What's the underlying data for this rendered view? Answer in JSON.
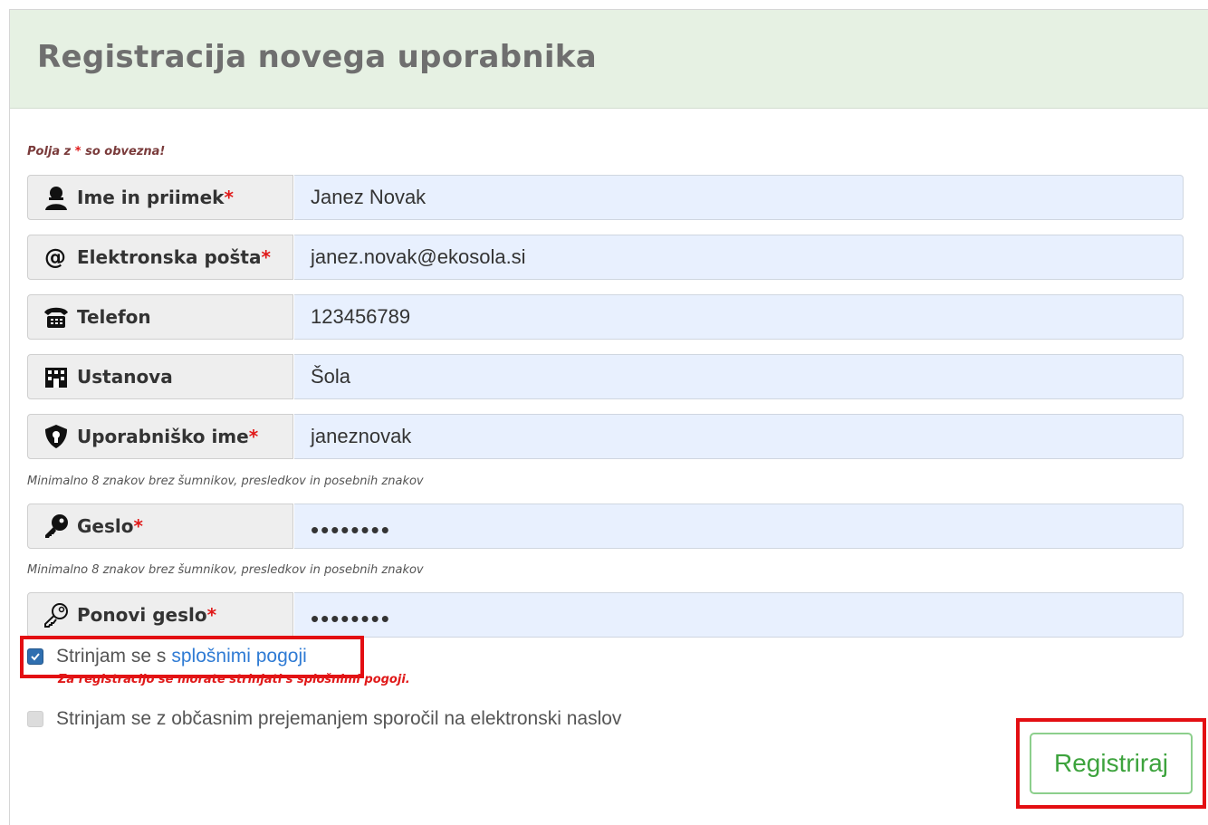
{
  "title": "Registracija novega uporabnika",
  "required_note": {
    "prefix": "Polja z ",
    "star": "*",
    "suffix": " so obvezna!"
  },
  "fields": [
    {
      "label": "Ime in priimek",
      "required": "*",
      "value": "Janez Novak",
      "icon": "user-icon"
    },
    {
      "label": "Elektronska pošta",
      "required": "*",
      "value": "janez.novak@ekosola.si",
      "icon": "at-icon"
    },
    {
      "label": "Telefon",
      "required": "",
      "value": "123456789",
      "icon": "phone-icon"
    },
    {
      "label": "Ustanova",
      "required": "",
      "value": "Šola",
      "icon": "building-icon"
    },
    {
      "label": "Uporabniško ime",
      "required": "*",
      "value": "janeznovak",
      "icon": "shield-icon"
    },
    {
      "label": "Geslo",
      "required": "*",
      "value": "••••••••",
      "icon": "key-icon"
    },
    {
      "label": "Ponovi geslo",
      "required": "*",
      "value": "••••••••",
      "icon": "key-outline-icon"
    }
  ],
  "hints": {
    "username": "Minimalno 8 znakov brez šumnikov, presledkov in posebnih znakov",
    "password": "Minimalno 8 znakov brez šumnikov, presledkov in posebnih znakov"
  },
  "terms": {
    "text": "Strinjam se s",
    "link": "splošnimi pogoji",
    "checked": true
  },
  "terms_error": "Za registracijo se morate strinjati s splošnimi pogoji.",
  "newsletter": {
    "text": "Strinjam se z občasnim prejemanjem sporočil na elektronski naslov",
    "checked": false
  },
  "submit_label": "Registriraj",
  "colors": {
    "header_bg": "#e6f1e3",
    "field_bg": "#e8f0fe",
    "required": "#e01919",
    "button": "#3da33d",
    "highlight": "#e30e12",
    "link": "#2f7bd4"
  }
}
